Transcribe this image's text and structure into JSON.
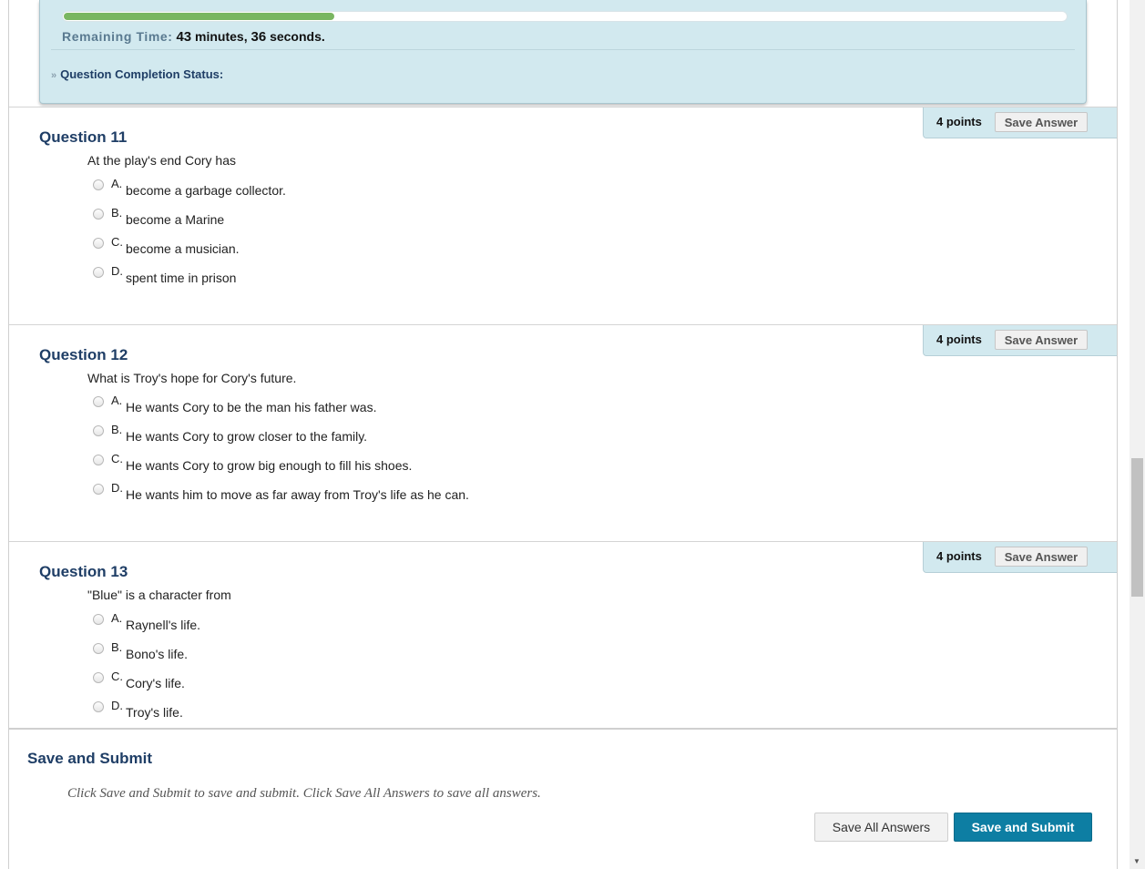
{
  "timer": {
    "progress_fraction": 0.27,
    "label": "Remaining Time:",
    "minutes": "43",
    "minutes_unit": "minutes,",
    "seconds": "36",
    "seconds_unit": "seconds.",
    "completion_label": "Question Completion Status:",
    "completion_icon": "double-chevron-down-icon"
  },
  "questions": [
    {
      "title": "Question 11",
      "points": "4 points",
      "save_label": "Save Answer",
      "text": "At the play's end Cory has",
      "choices": [
        {
          "letter": "A.",
          "text": "become a garbage collector."
        },
        {
          "letter": "B.",
          "text": "become a Marine"
        },
        {
          "letter": "C.",
          "text": "become a musician."
        },
        {
          "letter": "D.",
          "text": "spent time in prison"
        }
      ]
    },
    {
      "title": "Question 12",
      "points": "4 points",
      "save_label": "Save Answer",
      "text": "What is Troy's hope for Cory's future.",
      "choices": [
        {
          "letter": "A.",
          "text": "He wants Cory to be the man his father was."
        },
        {
          "letter": "B.",
          "text": "He wants Cory to grow closer to the family."
        },
        {
          "letter": "C.",
          "text": "He wants Cory to grow big enough to fill his shoes."
        },
        {
          "letter": "D.",
          "text": "He wants him to move as far away from Troy's life as he can."
        }
      ]
    },
    {
      "title": "Question 13",
      "points": "4 points",
      "save_label": "Save Answer",
      "text": "\"Blue\" is a character from",
      "choices": [
        {
          "letter": "A.",
          "text": "Raynell's life."
        },
        {
          "letter": "B.",
          "text": "Bono's life."
        },
        {
          "letter": "C.",
          "text": "Cory's life."
        },
        {
          "letter": "D.",
          "text": "Troy's life."
        }
      ]
    }
  ],
  "submit": {
    "title": "Save and Submit",
    "instructions": "Click Save and Submit to save and submit. Click Save All Answers to save all answers.",
    "save_all_label": "Save All Answers",
    "save_submit_label": "Save and Submit"
  },
  "colors": {
    "panel_bg": "#d2e9ef",
    "progress": "#7ab661",
    "heading": "#1f3e66",
    "primary_button": "#0d7ea3"
  }
}
